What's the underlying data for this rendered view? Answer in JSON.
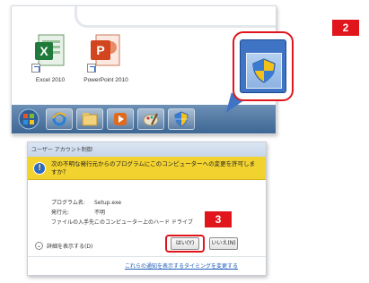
{
  "top_panel": {
    "icons": [
      {
        "label": "Excel 2010",
        "icon": "excel-icon",
        "color": "#1f7a3c"
      },
      {
        "label": "PowerPoint 2010",
        "icon": "powerpoint-icon",
        "color": "#d2461f"
      }
    ],
    "taskbar_items": [
      "start-orb-icon",
      "internet-explorer-icon",
      "folder-icon",
      "media-player-icon",
      "paint-icon",
      "uac-shield-icon"
    ]
  },
  "badges": {
    "step2": "2",
    "step3": "3"
  },
  "uac": {
    "title": "ユーザー アカウント制御",
    "warning": "次の不明な発行元からのプログラムにこのコンピューターへの変更を許可しますか？",
    "rows": [
      {
        "key": "プログラム名:",
        "value": "Setup.exe"
      },
      {
        "key": "発行元:",
        "value": "不明"
      },
      {
        "key": "ファイルの入手先:",
        "value": "このコンピューター上のハード ドライブ"
      }
    ],
    "expand_label": "詳細を表示する(D)",
    "yes_label": "はい(Y)",
    "no_label": "いいえ(N)",
    "link": "これらの通知を表示するタイミングを変更する"
  },
  "colors": {
    "accent_red": "#e0161c",
    "warning_yellow": "#f2d22e",
    "link_blue": "#1f5bb8"
  }
}
